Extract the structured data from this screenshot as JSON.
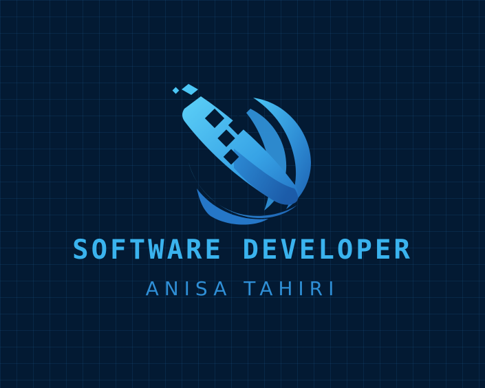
{
  "logo": {
    "emblem_icon": "globe-cursor-icon",
    "title": "SOFTWARE DEVELOPER",
    "subtitle": "ANISA TAHIRI",
    "colors": {
      "background": "#031a33",
      "grid": "#1e5a8c",
      "accent_light": "#4cc6f5",
      "accent_mid": "#2f8fd6",
      "accent_dark": "#1c5fb0"
    }
  }
}
